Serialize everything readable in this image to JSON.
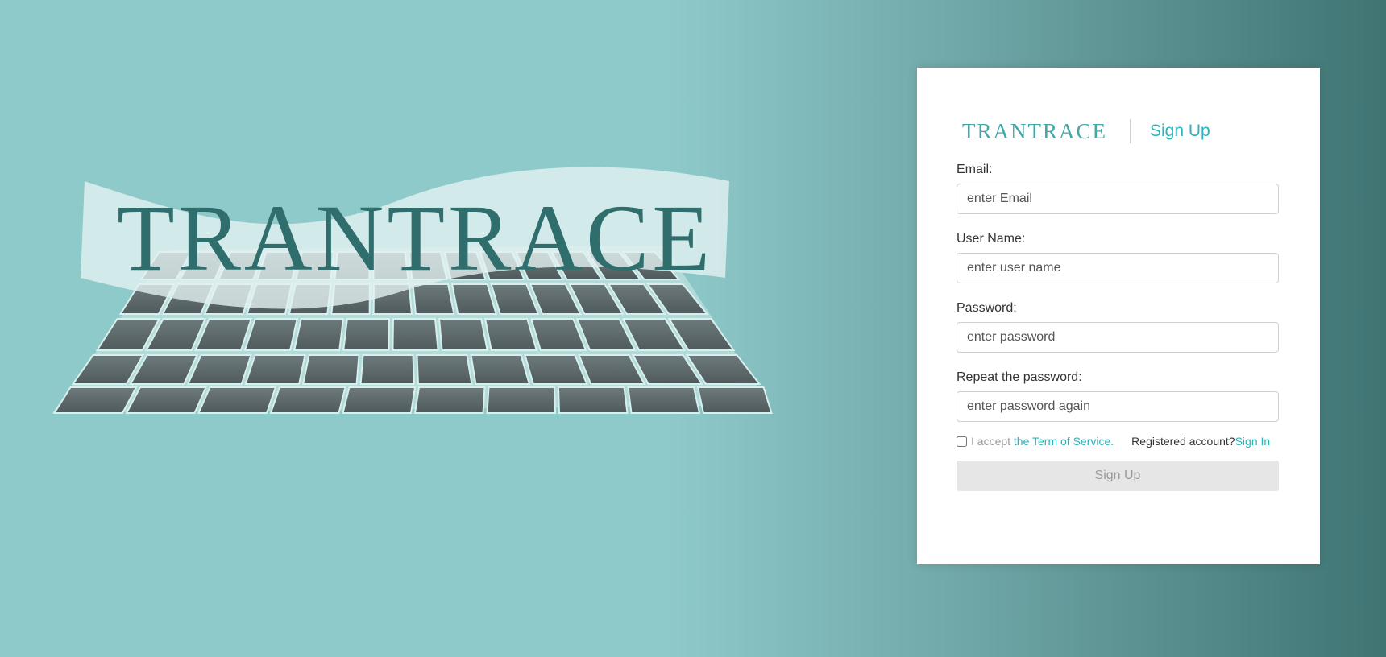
{
  "hero": {
    "logo_text": "TRANTRACE"
  },
  "card": {
    "brand": "TRANTRACE",
    "title": "Sign Up",
    "fields": [
      {
        "label": "Email:",
        "placeholder": "enter Email",
        "value": ""
      },
      {
        "label": "User Name:",
        "placeholder": "enter user name",
        "value": ""
      },
      {
        "label": "Password:",
        "placeholder": "enter password",
        "value": ""
      },
      {
        "label": "Repeat the password:",
        "placeholder": "enter password again",
        "value": ""
      }
    ],
    "terms": {
      "checked": false,
      "accept_text": "I accept",
      "terms_link": "the Term of Service.",
      "registered_text": "Registered account?",
      "signin_link": "Sign In"
    },
    "submit_label": "Sign Up"
  },
  "colors": {
    "accent": "#2ab3b8",
    "brand": "#44a7a8",
    "background_left": "#8fcacb",
    "background_right": "#3f7473",
    "key": "#5b6668",
    "button_disabled": "#e6e6e6"
  }
}
